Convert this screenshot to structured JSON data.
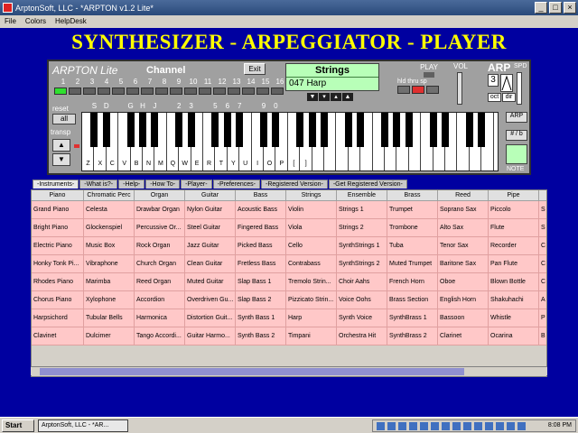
{
  "window": {
    "title": "ArptonSoft, LLC - *ARPTON v1.2 Lite*"
  },
  "menu": [
    "File",
    "Colors",
    "HelpDesk"
  ],
  "banner": "SYNTHESIZER - ARPEGGIATOR - PLAYER",
  "panel": {
    "brand": "ARPTON Lite",
    "channel_label": "Channel",
    "exit_label": "Exit",
    "instrument_name": "Strings",
    "patch": "047 Harp",
    "channels": [
      "1",
      "2",
      "3",
      "4",
      "5",
      "6",
      "7",
      "8",
      "9",
      "10",
      "11",
      "12",
      "13",
      "14",
      "15",
      "16"
    ],
    "active_channel": "1",
    "play_label": "PLAY",
    "hold_label": "hld thru sp",
    "vol_label": "VOL",
    "arp_label": "ARP",
    "spd_label": "SPD",
    "arp_value": "3",
    "oct_label": "oct",
    "dir_label": "dir",
    "reset_label": "reset",
    "all_label": "all",
    "transp_label": "transp",
    "arp_btn": "ARP",
    "sharp_btn": "# / b",
    "note_label": "NOTE",
    "white_keys": [
      "Z",
      "X",
      "C",
      "V",
      "B",
      "N",
      "M",
      "Q",
      "W",
      "E",
      "R",
      "T",
      "Y",
      "U",
      "I",
      "O",
      "P",
      "[",
      "]"
    ],
    "black_key_labels": [
      "S",
      "D",
      "G",
      "H",
      "J",
      "2",
      "3",
      "5",
      "6",
      "7",
      "9",
      "0"
    ]
  },
  "tabs": [
    "-Instruments-",
    "-What is?-",
    "-Help-",
    "-How To-",
    "-Player-",
    "-Preferences-",
    "-Registered Version-",
    "-Get Registered Version-"
  ],
  "table": {
    "headers": [
      "Piano",
      "Chromatic Perc",
      "Organ",
      "Guitar",
      "Bass",
      "Strings",
      "Ensemble",
      "Brass",
      "Reed",
      "Pipe",
      ""
    ],
    "rows": [
      [
        "Grand Piano",
        "Celesta",
        "Drawbar Organ",
        "Nylon Guitar",
        "Acoustic Bass",
        "Violin",
        "Strings 1",
        "Trumpet",
        "Soprano Sax",
        "Piccolo",
        "S"
      ],
      [
        "Bright Piano",
        "Glockenspiel",
        "Percussive Or...",
        "Steel Guitar",
        "Fingered Bass",
        "Viola",
        "Strings 2",
        "Trombone",
        "Alto Sax",
        "Flute",
        "S"
      ],
      [
        "Electric Piano",
        "Music Box",
        "Rock Organ",
        "Jazz Guitar",
        "Picked Bass",
        "Cello",
        "SynthStrings 1",
        "Tuba",
        "Tenor Sax",
        "Recorder",
        "C"
      ],
      [
        "Honky Tonk Pi...",
        "Vibraphone",
        "Church Organ",
        "Clean Guitar",
        "Fretless Bass",
        "Contrabass",
        "SynthStrings 2",
        "Muted Trumpet",
        "Baritone Sax",
        "Pan Flute",
        "C"
      ],
      [
        "Rhodes Piano",
        "Marimba",
        "Reed Organ",
        "Muted Guitar",
        "Slap Bass 1",
        "Tremolo Strin...",
        "Choir Aahs",
        "French Horn",
        "Oboe",
        "Blown Bottle",
        "C"
      ],
      [
        "Chorus Piano",
        "Xylophone",
        "Accordion",
        "Overdriven Gu...",
        "Slap Bass 2",
        "Pizzicato Strin...",
        "Voice Oohs",
        "Brass Section",
        "English Horn",
        "Shakuhachi",
        "A"
      ],
      [
        "Harpsichord",
        "Tubular Bells",
        "Harmonica",
        "Distortion Guit...",
        "Synth Bass 1",
        "Harp",
        "Synth Voice",
        "SynthBrass 1",
        "Bassoon",
        "Whistle",
        "P"
      ],
      [
        "Clavinet",
        "Dulcimer",
        "Tango Accordi...",
        "Guitar Harmo...",
        "Synth Bass 2",
        "Timpani",
        "Orchestra Hit",
        "SynthBrass 2",
        "Clarinet",
        "Ocarina",
        "B"
      ]
    ]
  },
  "taskbar": {
    "start": "Start",
    "task": "ArptonSoft, LLC - *AR...",
    "clock": "8:08 PM"
  }
}
